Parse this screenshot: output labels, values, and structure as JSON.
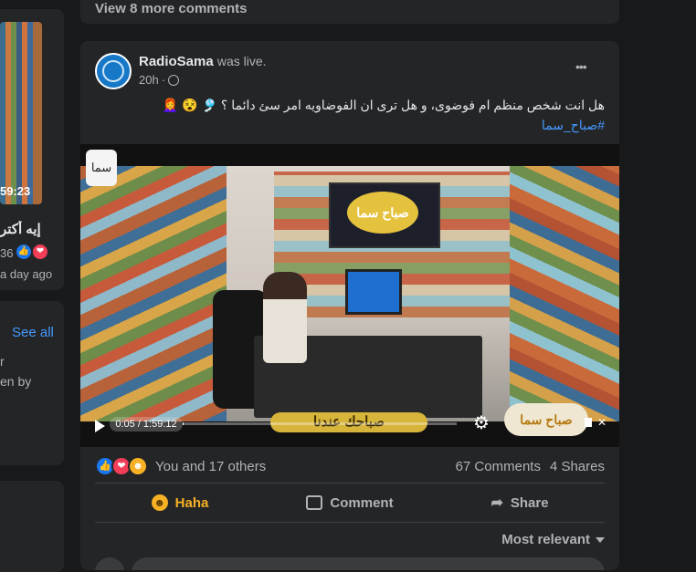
{
  "left_column": {
    "video_time": "59:23",
    "title_snippet": "إيه أكتر ",
    "reaction_count": "36",
    "time_ago": "a day ago",
    "see_all": "See all",
    "text_line_1": "r",
    "text_line_2": "en by"
  },
  "top_card": {
    "view_more": "View 8 more comments"
  },
  "post": {
    "author": "RadioSama",
    "status": "was live.",
    "time": "20h",
    "menu_label": "•••",
    "text": "هل انت شخص منظم ام فوضوى، و هل ترى ان الفوضاويه امر سئ دائما ؟ 🎐 😵 👩‍🦰",
    "hashtag": "#صباح_سما",
    "video": {
      "time_display": "0:05 / 1:59:12",
      "progress": 0.0007,
      "overlay_banner": "صباحك عندنا",
      "logo_text": "صباح سما",
      "tv_logo_text": "صباح سما",
      "corner_logo_text": "سما"
    },
    "reactions": {
      "summary": "You and 17 others",
      "comments": "67 Comments",
      "shares": "4 Shares"
    },
    "actions": [
      {
        "label": "Haha",
        "icon": "haha-icon"
      },
      {
        "label": "Comment",
        "icon": "comment-icon"
      },
      {
        "label": "Share",
        "icon": "share-icon"
      }
    ],
    "sort_label": "Most relevant"
  },
  "colors": {
    "background": "#18191a",
    "card": "#242526",
    "text_primary": "#e4e6eb",
    "text_secondary": "#b0b3b8",
    "link": "#4599ff",
    "haha_active": "#f7b125",
    "like_blue": "#1877f2",
    "love_red": "#f33e58"
  }
}
